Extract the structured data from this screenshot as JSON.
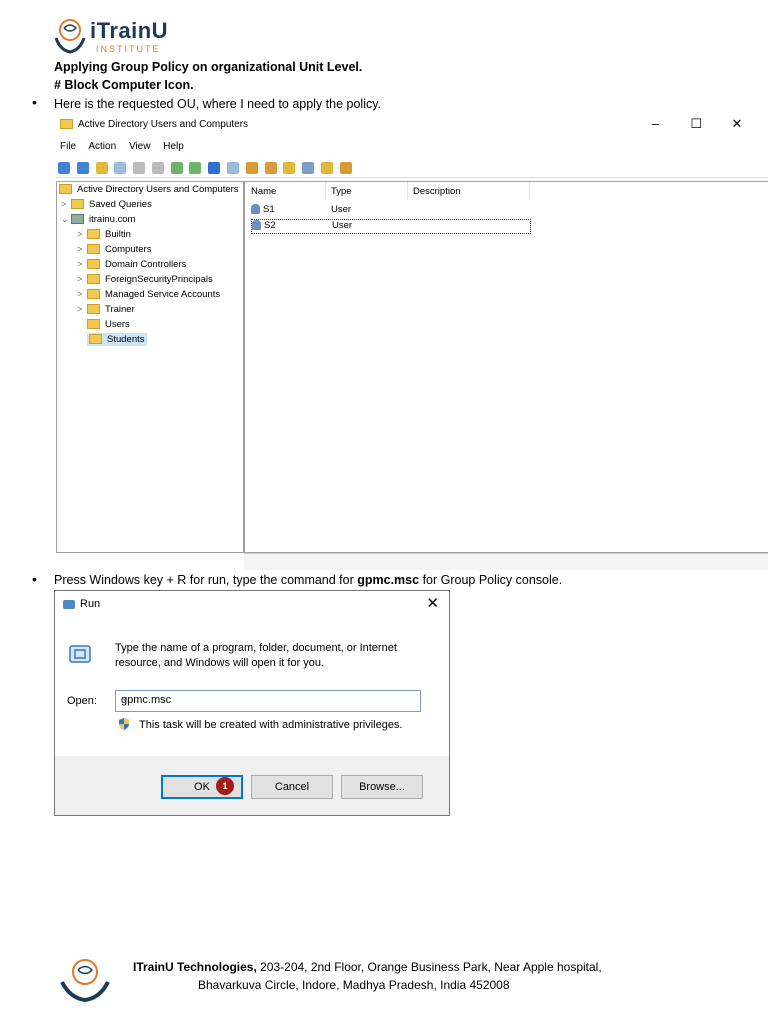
{
  "brand": {
    "logo_word": "iTrainU",
    "logo_sub": "INSTITUTE",
    "colors": {
      "navy": "#1d3a57",
      "orange": "#e07a2a",
      "badge": "#a31b1b"
    }
  },
  "heading": {
    "line1": "Applying Group Policy on organizational Unit Level.",
    "line2": "# Block Computer Icon."
  },
  "bullets": {
    "one": "Here is the requested OU, where I need to apply the policy.",
    "two_pre": "Press Windows key + R for run, type the command for ",
    "two_cmd": "gpmc.msc",
    "two_post": " for Group Policy console."
  },
  "aduc": {
    "title": "Active Directory Users and Computers",
    "controls": {
      "minimize": "–",
      "maximize": "☐",
      "close": "✕"
    },
    "menu": [
      "File",
      "Action",
      "View",
      "Help"
    ],
    "tree": [
      {
        "label": "Active Directory Users and Computers",
        "indent": 0,
        "arrow": ""
      },
      {
        "label": "Saved Queries",
        "indent": 1,
        "arrow": ">"
      },
      {
        "label": "itrainu.com",
        "indent": 1,
        "arrow": "⌄"
      },
      {
        "label": "Builtin",
        "indent": 2,
        "arrow": ">"
      },
      {
        "label": "Computers",
        "indent": 2,
        "arrow": ">"
      },
      {
        "label": "Domain Controllers",
        "indent": 2,
        "arrow": ">"
      },
      {
        "label": "ForeignSecurityPrincipals",
        "indent": 2,
        "arrow": ">"
      },
      {
        "label": "Managed Service Accounts",
        "indent": 2,
        "arrow": ">"
      },
      {
        "label": "Trainer",
        "indent": 2,
        "arrow": ">"
      },
      {
        "label": "Users",
        "indent": 2,
        "arrow": ""
      },
      {
        "label": "Students",
        "indent": 2,
        "arrow": "",
        "selected": true
      }
    ],
    "columns": [
      "Name",
      "Type",
      "Description"
    ],
    "rows": [
      {
        "name": "S1",
        "type": "User",
        "description": ""
      },
      {
        "name": "S2",
        "type": "User",
        "description": ""
      }
    ],
    "scroll_left": "<",
    "scroll_right": ">"
  },
  "run": {
    "title": "Run",
    "close": "✕",
    "description": "Type the name of a program, folder, document, or Internet resource, and Windows will open it for you.",
    "open_label": "Open:",
    "open_value": "gpmc.msc",
    "admin_note": "This task will be created with administrative privileges.",
    "ok": "OK",
    "cancel": "Cancel",
    "browse": "Browse...",
    "step_badge": "1"
  },
  "footer": {
    "company": "ITrainU Technologies,",
    "address1": " 203-204, 2nd Floor, Orange Business Park, Near Apple hospital,",
    "address2": "Bhavarkuva Circle, Indore, Madhya Pradesh, India 452008"
  }
}
